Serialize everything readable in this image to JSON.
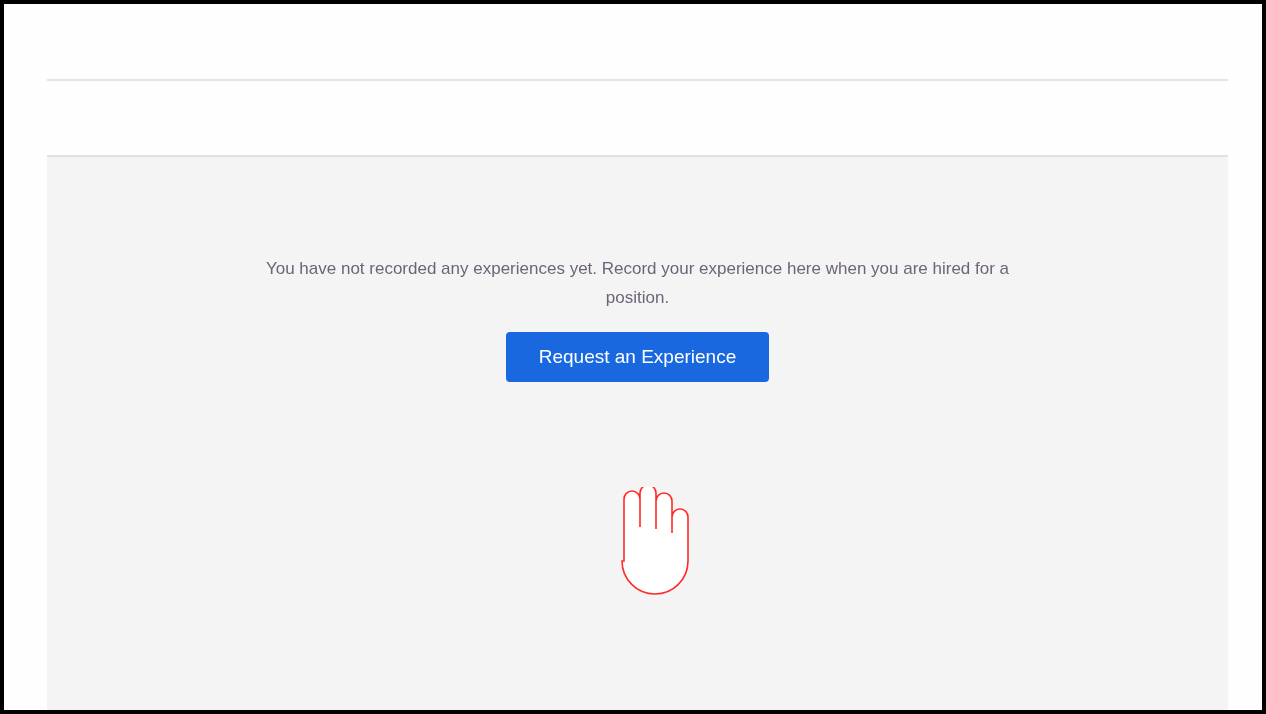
{
  "empty_state": {
    "message": "You have not recorded any experiences yet. Record your experience here when you are hired for a position.",
    "button": "Request an Experience"
  }
}
